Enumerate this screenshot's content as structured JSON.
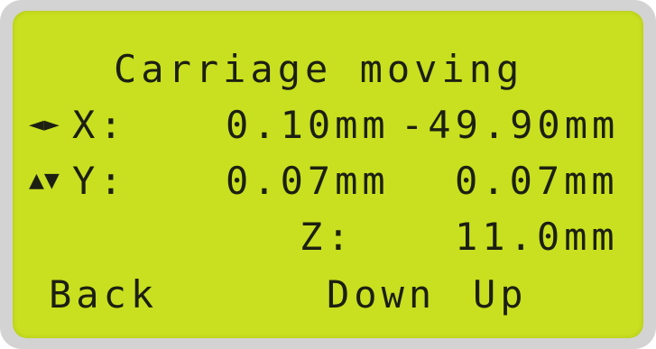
{
  "screen": {
    "title": "Carriage moving",
    "x_row": {
      "arrows": "◄►",
      "axis": "X:",
      "value": "0.10mm",
      "value2": "-49.90mm"
    },
    "y_row": {
      "arrows": "▲▼",
      "axis": "Y:",
      "value": "0.07mm",
      "value2": "0.07mm"
    },
    "z_row": {
      "axis": "Z:",
      "value": "11.0mm"
    },
    "softkeys": {
      "back": "Back",
      "down": "Down",
      "up": "Up"
    }
  },
  "colors": {
    "lcd_background": "#c8e01f",
    "lcd_text": "#1c1f12",
    "bezel": "#d3d3d3"
  }
}
